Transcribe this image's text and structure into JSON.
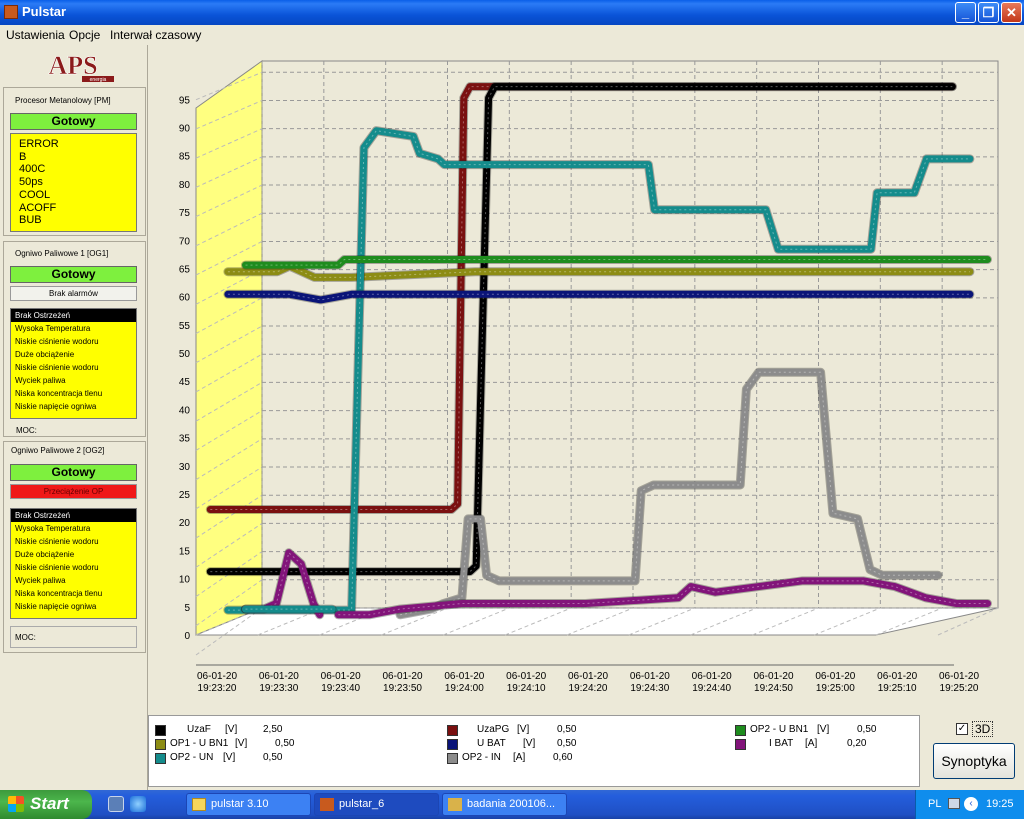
{
  "window": {
    "title": "Pulstar"
  },
  "menu": [
    "Ustawienia",
    "Opcje",
    "Interwał czasowy"
  ],
  "logo": {
    "text": "APS",
    "subtext": "energia"
  },
  "pm": {
    "label": "Procesor Metanolowy [PM]",
    "status": "Gotowy",
    "lines": [
      "ERROR",
      "B",
      "400C",
      "50ps",
      "COOL",
      "ACOFF",
      "BUB"
    ]
  },
  "og1": {
    "label": "Ogniwo Paliwowe 1 [OG1]",
    "status": "Gotowy",
    "alarm": "Brak alarmów",
    "warnings": [
      "Brak Ostrzeżeń",
      "Wysoka Temperatura",
      "Niskie ciśnienie wodoru",
      "Duże obciążenie",
      "Niskie ciśnienie wodoru",
      "Wyciek paliwa",
      "Niska koncentracja tlenu",
      "Niskie napięcie ogniwa"
    ],
    "moc": "MOC:"
  },
  "og2": {
    "label": "Ogniwo Paliwowe 2 [OG2]",
    "status": "Gotowy",
    "alarm": "Przeciążenie OP",
    "warnings": [
      "Brak Ostrzeżeń",
      "Wysoka Temperatura",
      "Niskie ciśnienie wodoru",
      "Duże obciążenie",
      "Niskie ciśnienie wodoru",
      "Wyciek paliwa",
      "Niska koncentracja tlenu",
      "Niskie napięcie ogniwa"
    ],
    "moc": "MOC:"
  },
  "legend": [
    {
      "name": "UzaF",
      "unit": "[V]",
      "value": "2,50",
      "color": "#000000"
    },
    {
      "name": "UzaPG",
      "unit": "[V]",
      "value": "0,50",
      "color": "#7a1010"
    },
    {
      "name": "OP2 - U BN1",
      "unit": "[V]",
      "value": "0,50",
      "color": "#1e8c1e"
    },
    {
      "name": "OP1 - U BN1",
      "unit": "[V]",
      "value": "0,50",
      "color": "#8c8c14"
    },
    {
      "name": "U BAT",
      "unit": "[V]",
      "value": "0,50",
      "color": "#0a1478"
    },
    {
      "name": "I BAT",
      "unit": "[A]",
      "value": "0,20",
      "color": "#82147a"
    },
    {
      "name": "OP2 - UN",
      "unit": "[V]",
      "value": "0,50",
      "color": "#148c8c"
    },
    {
      "name": "OP2 - IN",
      "unit": "[A]",
      "value": "0,60",
      "color": "#8c8c8c"
    }
  ],
  "controls": {
    "checkbox_mark": "✓",
    "three_d_label": "3D",
    "synoptyka_label": "Synoptyka"
  },
  "taskbar": {
    "start": "Start",
    "tasks": [
      "pulstar 3.10",
      "pulstar_6",
      "badania 200106..."
    ],
    "lang": "PL",
    "clock": "19:25"
  },
  "chart_data": {
    "type": "line",
    "three_d": true,
    "grid": true,
    "ylim": [
      0,
      97
    ],
    "yticks": [
      0,
      5,
      10,
      15,
      20,
      25,
      30,
      35,
      40,
      45,
      50,
      55,
      60,
      65,
      70,
      75,
      80,
      85,
      90,
      95
    ],
    "xlim": [
      0,
      120
    ],
    "xticks": [
      {
        "t": 0,
        "date": "06-01-20",
        "time": "19:23:20"
      },
      {
        "t": 10,
        "date": "06-01-20",
        "time": "19:23:30"
      },
      {
        "t": 20,
        "date": "06-01-20",
        "time": "19:23:40"
      },
      {
        "t": 30,
        "date": "06-01-20",
        "time": "19:23:50"
      },
      {
        "t": 40,
        "date": "06-01-20",
        "time": "19:24:00"
      },
      {
        "t": 50,
        "date": "06-01-20",
        "time": "19:24:10"
      },
      {
        "t": 60,
        "date": "06-01-20",
        "time": "19:24:20"
      },
      {
        "t": 70,
        "date": "06-01-20",
        "time": "19:24:30"
      },
      {
        "t": 80,
        "date": "06-01-20",
        "time": "19:24:40"
      },
      {
        "t": 90,
        "date": "06-01-20",
        "time": "19:24:50"
      },
      {
        "t": 100,
        "date": "06-01-20",
        "time": "19:25:00"
      },
      {
        "t": 110,
        "date": "06-01-20",
        "time": "19:25:10"
      },
      {
        "t": 120,
        "date": "06-01-20",
        "time": "19:25:20"
      }
    ],
    "series": [
      {
        "name": "OP2 - IN [A]",
        "color": "#8c8c8c",
        "depth": 0,
        "points": [
          [
            25,
            0
          ],
          [
            30,
            1
          ],
          [
            32,
            2
          ],
          [
            35,
            3
          ],
          [
            36,
            17
          ],
          [
            38,
            17
          ],
          [
            39,
            7
          ],
          [
            41,
            6
          ],
          [
            46,
            6
          ],
          [
            55,
            6
          ],
          [
            63,
            6
          ],
          [
            64,
            22
          ],
          [
            66,
            23
          ],
          [
            80,
            23
          ],
          [
            81,
            40
          ],
          [
            83,
            43
          ],
          [
            93,
            43
          ],
          [
            95,
            18
          ],
          [
            99,
            17
          ],
          [
            101,
            8
          ],
          [
            103,
            7
          ],
          [
            112,
            7
          ]
        ]
      },
      {
        "name": "OP2 - U BN1 [V]",
        "color": "#1e8c1e",
        "depth": 0,
        "points": [
          [
            0,
            62
          ],
          [
            15,
            62
          ],
          [
            16,
            63
          ],
          [
            20,
            63
          ],
          [
            40,
            63
          ],
          [
            120,
            63
          ]
        ]
      },
      {
        "name": "I BAT [A]",
        "color": "#82147a",
        "depth": 0,
        "points": [
          [
            15,
            0
          ],
          [
            20,
            0
          ],
          [
            25,
            1
          ],
          [
            35,
            2
          ],
          [
            55,
            2
          ],
          [
            70,
            3
          ],
          [
            72,
            5
          ],
          [
            76,
            4
          ],
          [
            90,
            6
          ],
          [
            100,
            6
          ],
          [
            105,
            5
          ],
          [
            110,
            3
          ],
          [
            115,
            2
          ],
          [
            120,
            2
          ]
        ]
      },
      {
        "name": "OP1 - U BN1 [V]",
        "color": "#8c8c14",
        "depth": 1,
        "points": [
          [
            0,
            62
          ],
          [
            8,
            62
          ],
          [
            10,
            63
          ],
          [
            14,
            61
          ],
          [
            20,
            61
          ],
          [
            40,
            62
          ],
          [
            120,
            62
          ]
        ]
      },
      {
        "name": "OP2 - UN [V]",
        "color": "#148c8c",
        "depth": 1,
        "points": [
          [
            0,
            2
          ],
          [
            20,
            2
          ],
          [
            22,
            84
          ],
          [
            24,
            87
          ],
          [
            30,
            86
          ],
          [
            31,
            83
          ],
          [
            34,
            82
          ],
          [
            35,
            81
          ],
          [
            40,
            81
          ],
          [
            48,
            81
          ],
          [
            55,
            81
          ],
          [
            68,
            81
          ],
          [
            69,
            73
          ],
          [
            75,
            73
          ],
          [
            87,
            73
          ],
          [
            89,
            66
          ],
          [
            96,
            66
          ],
          [
            104,
            66
          ],
          [
            105,
            76
          ],
          [
            111,
            76
          ],
          [
            113,
            82
          ],
          [
            120,
            82
          ]
        ]
      },
      {
        "name": "U BAT [V]",
        "color": "#0a1478",
        "depth": 1,
        "points": [
          [
            0,
            58
          ],
          [
            10,
            58
          ],
          [
            15,
            57
          ],
          [
            20,
            58
          ],
          [
            40,
            58
          ],
          [
            120,
            58
          ]
        ]
      },
      {
        "name": "UzaPG [V]",
        "color": "#7a1010",
        "depth": 2,
        "points": [
          [
            0,
            21
          ],
          [
            39,
            21
          ],
          [
            40,
            22
          ],
          [
            41,
            94
          ],
          [
            42,
            96
          ],
          [
            120,
            96
          ]
        ]
      },
      {
        "name": "UzaF [V]",
        "color": "#000000",
        "depth": 2,
        "points": [
          [
            0,
            10
          ],
          [
            42,
            10
          ],
          [
            43,
            11
          ],
          [
            45,
            94
          ],
          [
            46,
            96
          ],
          [
            120,
            96
          ]
        ]
      }
    ],
    "bottom_series_extra": [
      {
        "name": "I BAT start",
        "color": "#82147a",
        "points": [
          [
            0,
            1
          ],
          [
            3,
            1
          ],
          [
            5,
            2
          ],
          [
            7,
            11
          ],
          [
            9,
            9
          ],
          [
            11,
            2
          ],
          [
            12,
            0
          ]
        ]
      },
      {
        "name": "OP2 - UN start",
        "color": "#148c8c",
        "points": [
          [
            0,
            1
          ],
          [
            14,
            1
          ]
        ]
      }
    ]
  }
}
